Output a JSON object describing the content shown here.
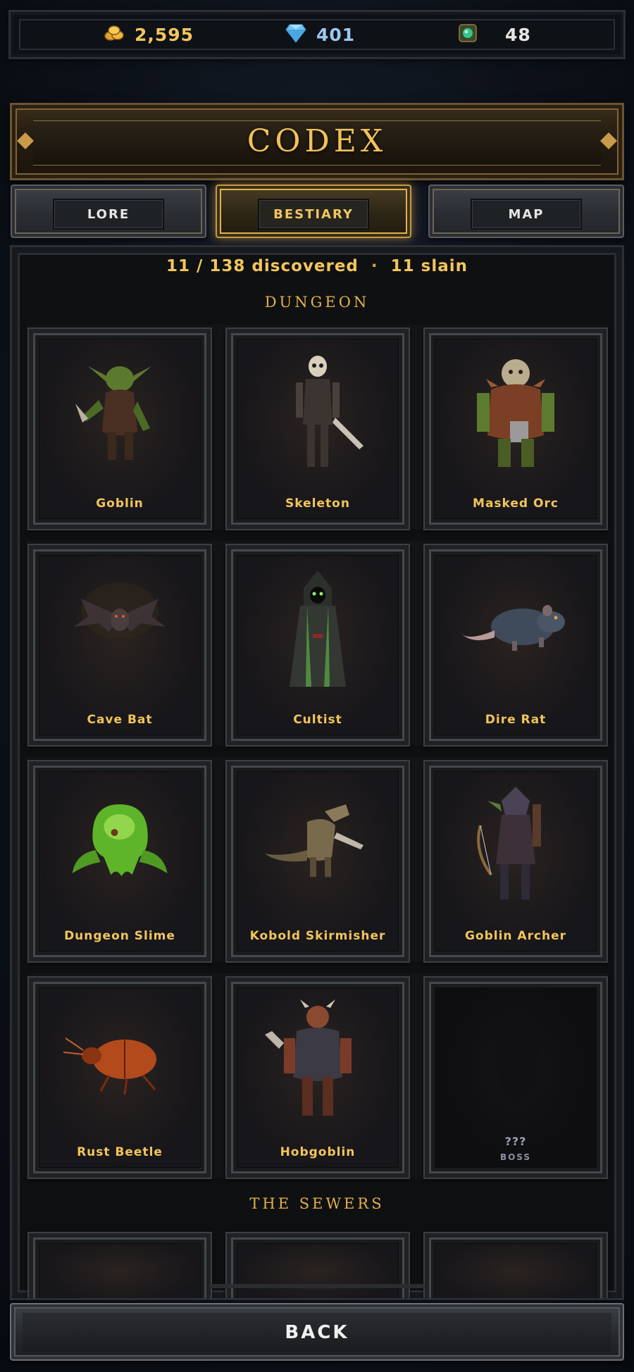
{
  "currencies": {
    "gold": "2,595",
    "gems": "401",
    "essence": "48"
  },
  "header": {
    "title": "CODEX"
  },
  "tabs": [
    {
      "label": "LORE",
      "active": false
    },
    {
      "label": "BESTIARY",
      "active": true
    },
    {
      "label": "MAP",
      "active": false
    }
  ],
  "codex": {
    "discovered": "11 / 138 discovered",
    "separator": "·",
    "slain": "11 slain",
    "sections": [
      {
        "title": "DUNGEON",
        "creatures": [
          {
            "name": "Goblin",
            "icon": "goblin-icon"
          },
          {
            "name": "Skeleton",
            "icon": "skeleton-icon"
          },
          {
            "name": "Masked Orc",
            "icon": "orc-icon"
          },
          {
            "name": "Cave Bat",
            "icon": "bat-icon"
          },
          {
            "name": "Cultist",
            "icon": "cultist-icon"
          },
          {
            "name": "Dire Rat",
            "icon": "rat-icon"
          },
          {
            "name": "Dungeon Slime",
            "icon": "slime-icon"
          },
          {
            "name": "Kobold Skirmisher",
            "icon": "kobold-icon"
          },
          {
            "name": "Goblin Archer",
            "icon": "goblin-archer-icon"
          },
          {
            "name": "Rust Beetle",
            "icon": "beetle-icon"
          },
          {
            "name": "Hobgoblin",
            "icon": "hobgoblin-icon"
          },
          {
            "name": "???",
            "tag": "BOSS",
            "icon": "silhouette-icon",
            "locked": true
          }
        ]
      },
      {
        "title": "THE SEWERS"
      }
    ]
  },
  "footer": {
    "back_label": "BACK"
  },
  "colors": {
    "gold_text": "#f2c55c",
    "gem_text": "#9cc7f0",
    "panel_bg": "#0f1012",
    "active_tab_border": "#e3b14c"
  }
}
